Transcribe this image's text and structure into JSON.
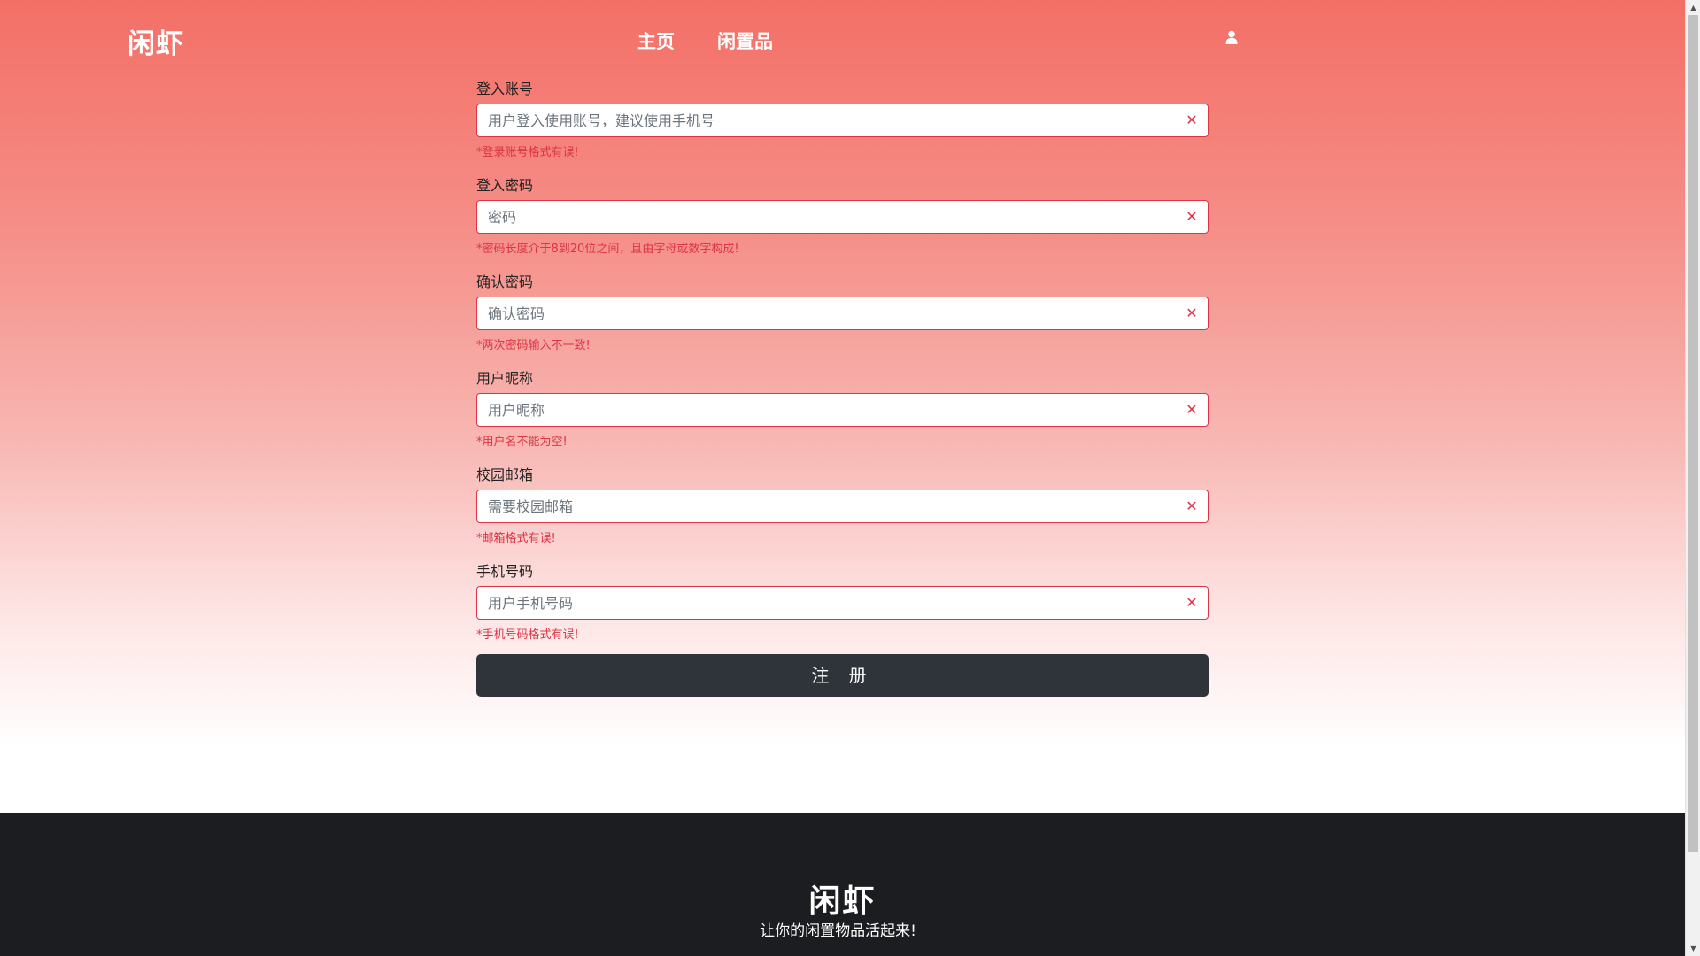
{
  "nav": {
    "logo": "闲虾",
    "links": [
      "主页",
      "闲置品"
    ],
    "user_icon": "user-icon"
  },
  "form": {
    "fields": [
      {
        "label": "登入账号",
        "placeholder": "用户登入使用账号，建议使用手机号",
        "error": "*登录账号格式有误!"
      },
      {
        "label": "登入密码",
        "placeholder": "密码",
        "error": "*密码长度介于8到20位之间，且由字母或数字构成!"
      },
      {
        "label": "确认密码",
        "placeholder": "确认密码",
        "error": "*两次密码输入不一致!"
      },
      {
        "label": "用户昵称",
        "placeholder": "用户昵称",
        "error": "*用户名不能为空!"
      },
      {
        "label": "校园邮箱",
        "placeholder": "需要校园邮箱",
        "error": "*邮箱格式有误!"
      },
      {
        "label": "手机号码",
        "placeholder": "用户手机号码",
        "error": "*手机号码格式有误!"
      }
    ],
    "clear_icon": "✕",
    "submit_label": "注 册"
  },
  "footer": {
    "logo": "闲虾",
    "slogan": "让你的闲置物品活起来!"
  },
  "colors": {
    "accent_top": "#f36f66",
    "error": "#dc3545",
    "button": "#2f343b",
    "footer": "#1c1d20"
  }
}
